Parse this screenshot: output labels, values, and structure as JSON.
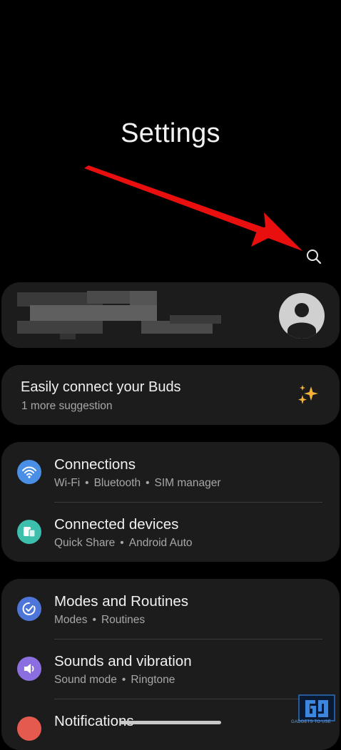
{
  "header": {
    "title": "Settings"
  },
  "search": {
    "icon": "search-icon"
  },
  "suggestion": {
    "title": "Easily connect your Buds",
    "subtitle": "1 more suggestion",
    "icon": "sparkle-icon",
    "icon_color": "#f5b13a"
  },
  "groups": [
    {
      "items": [
        {
          "title": "Connections",
          "subs": [
            "Wi-Fi",
            "Bluetooth",
            "SIM manager"
          ],
          "icon": "wifi-icon",
          "color": "#4a8fe6"
        },
        {
          "title": "Connected devices",
          "subs": [
            "Quick Share",
            "Android Auto"
          ],
          "icon": "connected-devices-icon",
          "color": "#3dbfae"
        }
      ]
    },
    {
      "items": [
        {
          "title": "Modes and Routines",
          "subs": [
            "Modes",
            "Routines"
          ],
          "icon": "modes-routines-icon",
          "color": "#4e76d8"
        },
        {
          "title": "Sounds and vibration",
          "subs": [
            "Sound mode",
            "Ringtone"
          ],
          "icon": "speaker-icon",
          "color": "#8b6fe0"
        },
        {
          "title": "Notifications",
          "subs": [],
          "icon": "notifications-icon",
          "color": "#e45a4f"
        }
      ]
    }
  ],
  "separator": "•",
  "watermark": {
    "sub": "GADGETS TO USE"
  }
}
